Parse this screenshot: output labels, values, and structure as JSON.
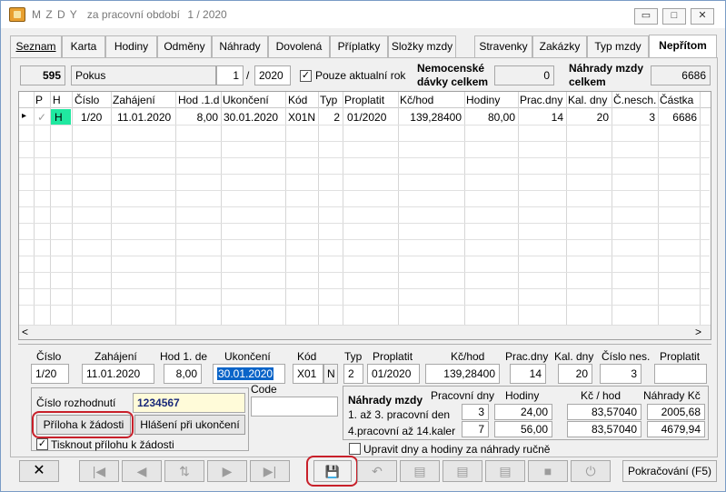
{
  "window": {
    "title": "M Z D Y",
    "period_label": "za pracovní období",
    "period_value": "1 / 2020",
    "minimize_glyph": "▭",
    "maximize_glyph": "□",
    "close_glyph": "✕"
  },
  "tabs": [
    "Seznam",
    "Karta",
    "Hodiny",
    "Odměny",
    "Náhrady",
    "Dovolená",
    "Příplatky",
    "Složky mzdy",
    "Stravenky",
    "Zakázky",
    "Typ mzdy",
    "Nepřítom"
  ],
  "header": {
    "employee_no": "595",
    "employee_name": "Pokus",
    "month": "1",
    "separator": "/",
    "year": "2020",
    "only_current_year_label": "Pouze aktualní rok",
    "sick_benefits_label_1": "Nemocenské",
    "sick_benefits_label_2": "dávky celkem",
    "sick_benefits_value": "0",
    "wage_comp_label_1": "Náhrady mzdy",
    "wage_comp_label_2": "celkem",
    "wage_comp_value": "6686"
  },
  "grid": {
    "columns": [
      "P",
      "H",
      "Číslo",
      "Zahájení",
      "Hod .1.d",
      "Ukončení",
      "Kód",
      "Typ",
      "Proplatit",
      "Kč/hod",
      "Hodiny",
      "Prac.dny",
      "Kal. dny",
      "Č.nesch.",
      "Částka"
    ],
    "row": {
      "marker": "▸",
      "p": "✓",
      "h": "H",
      "cislo": "1/20",
      "zahajeni": "11.01.2020",
      "hod1d": "8,00",
      "ukonceni": "30.01.2020",
      "kod": "X01N",
      "typ": "2",
      "proplatit": "01/2020",
      "kc_hod": "139,28400",
      "hodiny": "80,00",
      "prac_dny": "14",
      "kal_dny": "20",
      "c_nesch": "3",
      "castka": "6686"
    },
    "scroll_left": "<",
    "scroll_right": ">"
  },
  "detail": {
    "labels": {
      "cislo": "Číslo",
      "zahajeni": "Zahájení",
      "hod1de": "Hod 1. de",
      "ukonceni": "Ukončení",
      "kod": "Kód",
      "typ": "Typ",
      "proplatit": "Proplatit",
      "kc_hod": "Kč/hod",
      "prac_dny": "Prac.dny",
      "kal_dny": "Kal. dny",
      "cislo_nes": "Číslo nes.",
      "proplatit2": "Proplatit",
      "code": "Code",
      "cislo_rozhodnuti": "Číslo rozhodnutí"
    },
    "values": {
      "cislo": "1/20",
      "zahajeni": "11.01.2020",
      "hod1de": "8,00",
      "ukonceni": "30.01.2020",
      "kod": "X01",
      "kod_suffix": "N",
      "typ": "2",
      "proplatit": "01/2020",
      "kc_hod": "139,28400",
      "prac_dny": "14",
      "kal_dny": "20",
      "cislo_nes": "3",
      "proplatit2": "",
      "code": "",
      "cislo_rozhodnuti": "1234567"
    },
    "priloha_button": "Příloha k žádosti",
    "hlaseni_button": "Hlášení při ukončení",
    "print_attachment_label": "Tisknout přílohu k žádosti"
  },
  "comp": {
    "title": "Náhrady mzdy",
    "col_days": "Pracovní dny",
    "col_hours": "Hodiny",
    "col_rate": "Kč / hod",
    "col_comp": "Náhrady Kč",
    "rows": [
      {
        "label": "1. až 3. pracovní den",
        "days": "3",
        "hours": "24,00",
        "rate": "83,57040",
        "comp": "2005,68"
      },
      {
        "label": "4.pracovní až 14.kaler",
        "days": "7",
        "hours": "56,00",
        "rate": "83,57040",
        "comp": "4679,94"
      }
    ],
    "manual_label": "Upravit dny a hodiny za náhrady ručně"
  },
  "toolbar": {
    "close_glyph": "✕",
    "first_glyph": "|◀",
    "prev_glyph": "◀",
    "sort_glyph": "⇅",
    "next_glyph": "▶",
    "last_glyph": "▶|",
    "save_glyph": "💾",
    "undo_glyph": "↶",
    "print_glyph": "▤",
    "stop_glyph": "■",
    "power_glyph": "⏻",
    "continue_label": "Pokračování (F5)"
  },
  "colors": {
    "highlight": "#c8202a",
    "h_cell": "#20e8a0",
    "selection": "#0a64c8",
    "decision_bg": "#fffbd9"
  }
}
